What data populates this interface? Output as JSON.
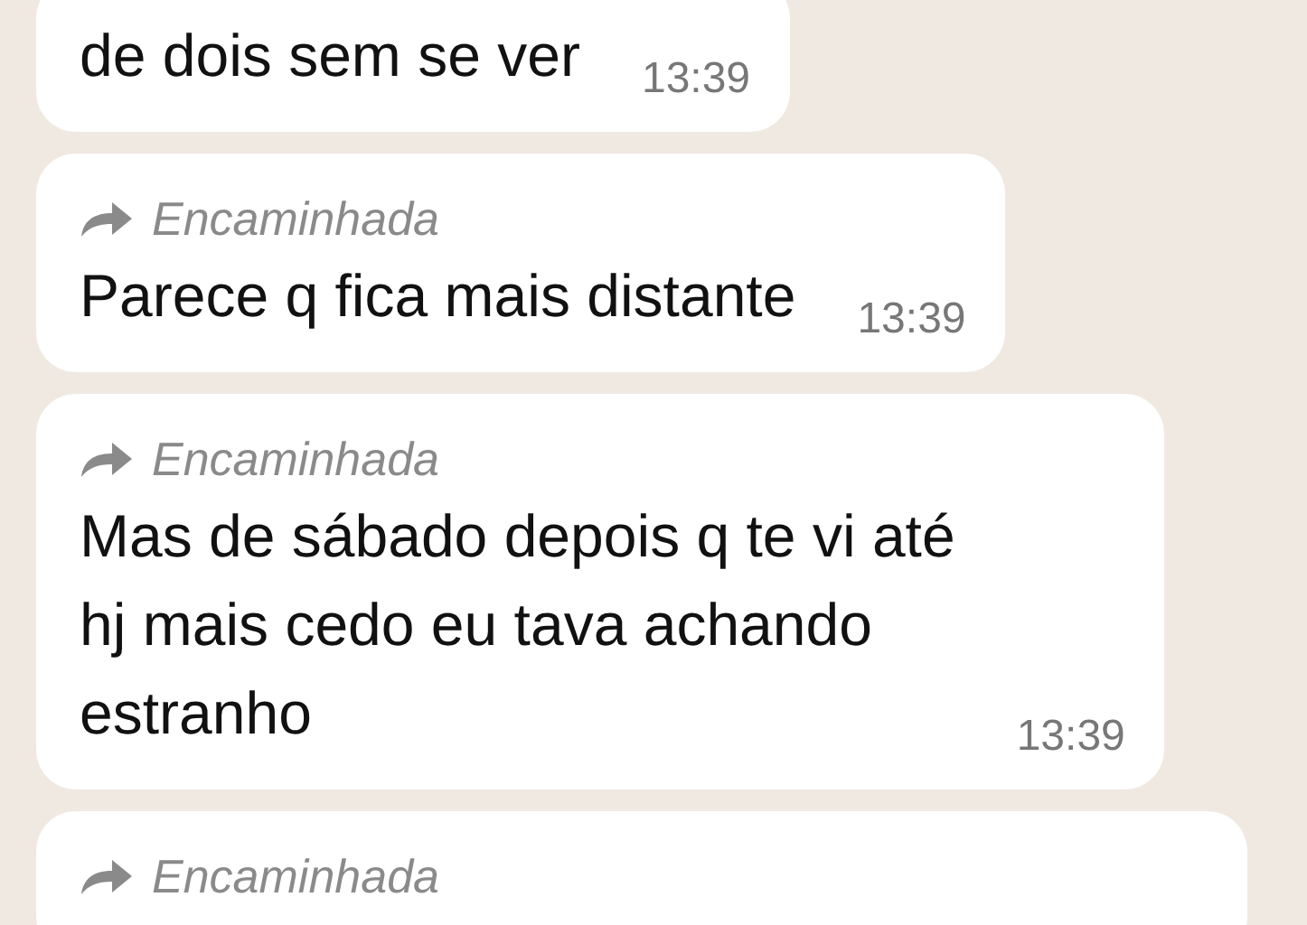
{
  "messages": [
    {
      "forwarded": false,
      "lines": [
        "de dois sem se ver"
      ],
      "time": "13:39"
    },
    {
      "forwarded": true,
      "forwarded_label": "Encaminhada",
      "lines": [
        "Parece q fica mais distante"
      ],
      "time": "13:39"
    },
    {
      "forwarded": true,
      "forwarded_label": "Encaminhada",
      "lines": [
        "Mas de sábado depois q te vi até",
        "hj mais cedo eu tava achando",
        "estranho"
      ],
      "time": "13:39"
    },
    {
      "forwarded": true,
      "forwarded_label": "Encaminhada"
    }
  ]
}
